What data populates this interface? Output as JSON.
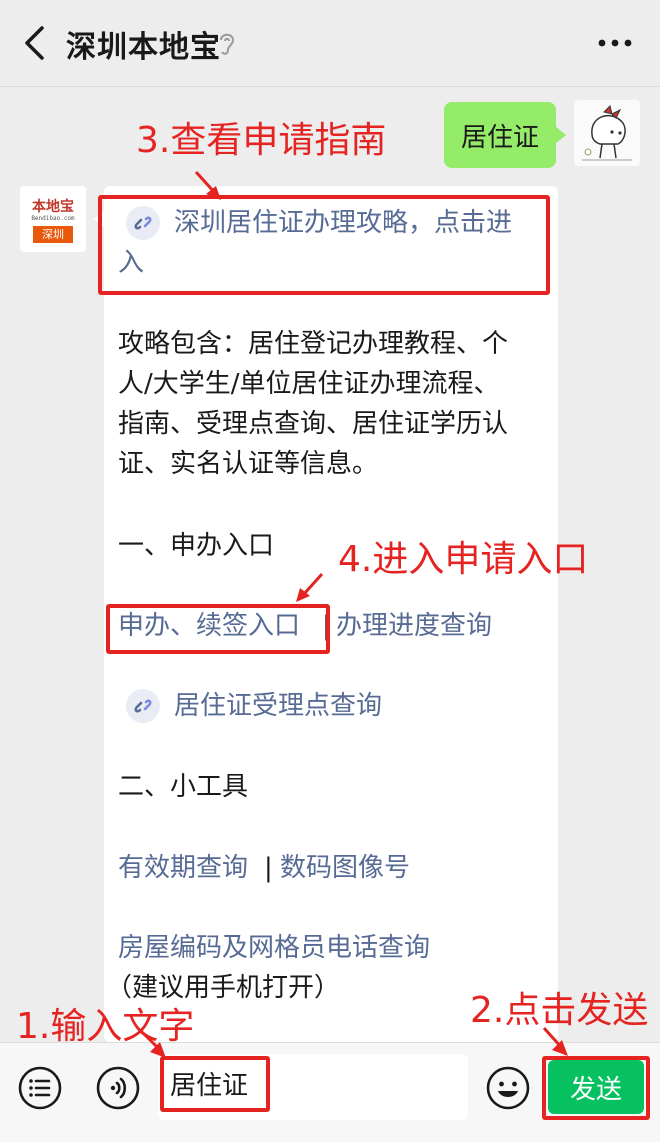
{
  "header": {
    "title": "深圳本地宝"
  },
  "chat": {
    "user_message": "居住证",
    "bot_avatar": {
      "line1": "本地宝",
      "line2": "Bendibao.com",
      "line3": "深圳"
    },
    "card": {
      "link_title_line1": "深圳居住证办理攻略，点击进",
      "link_title_line2": "入",
      "intro_lines": [
        "攻略包含：居住登记办理教程、个",
        "人/大学生/单位居住证办理流程、",
        "指南、受理点查询、居住证学历认",
        "证、实名认证等信息。"
      ],
      "section1": "一、申办入口",
      "apply_link": "申办、续签入口",
      "sep1": "|",
      "progress_link": "办理进度查询",
      "site_link": "居住证受理点查询",
      "section2": "二、小工具",
      "validity_link": "有效期查询",
      "sep2": "|",
      "photo_link": "数码图像号",
      "house_link": "房屋编码及网格员电话查询",
      "house_note": "（建议用手机打开）"
    }
  },
  "annotations": {
    "step1": "1.输入文字",
    "step2": "2.点击发送",
    "step3": "3.查看申请指南",
    "step4": "4.进入申请入口"
  },
  "input": {
    "value": "居住证"
  },
  "send_button": "发送",
  "colors": {
    "accent_red": "#e52421",
    "link_blue": "#576b95",
    "bubble_green": "#95ec69",
    "send_green": "#07c160"
  }
}
